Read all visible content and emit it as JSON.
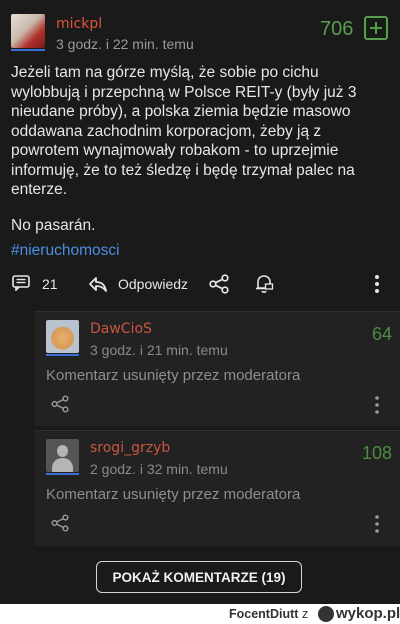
{
  "post": {
    "author": "mickpl",
    "timestamp": "3 godz. i 22 min. temu",
    "score": "706",
    "body_paragraph_1": "Jeżeli tam na górze myślą, że sobie po cichu wylobbują i przepchną w Polsce REIT-y (były już 3 nieudane próby), a polska ziemia będzie masowo oddawana zachodnim korporacjom, żeby ją z powrotem wynajmowały robakom - to uprzejmie informuję, że to też śledzę i będę trzymał palec na enterze.",
    "body_paragraph_2": "No pasarán.",
    "hashtag": "#nieruchomosci"
  },
  "actions": {
    "comment_count": "21",
    "reply_label": "Odpowiedz"
  },
  "comments": [
    {
      "author": "DawCioS",
      "timestamp": "3 godz. i 21 min. temu",
      "score": "64",
      "text": "Komentarz usunięty przez moderatora"
    },
    {
      "author": "srogi_grzyb",
      "timestamp": "2 godz. i 32 min. temu",
      "score": "108",
      "text": "Komentarz usunięty przez moderatora"
    }
  ],
  "show_more_label": "POKAŻ KOMENTARZE (19)",
  "footer": {
    "username": "FocentDiutt",
    "separator": "z",
    "brand": "wykop.pl"
  },
  "colors": {
    "background": "#1a1a1a",
    "author": "#e0533b",
    "score": "#57a04b",
    "link": "#4b8ee0"
  },
  "icons": [
    "plus-icon",
    "comment-icon",
    "reply-icon",
    "share-icon",
    "bell-icon",
    "more-icon"
  ]
}
